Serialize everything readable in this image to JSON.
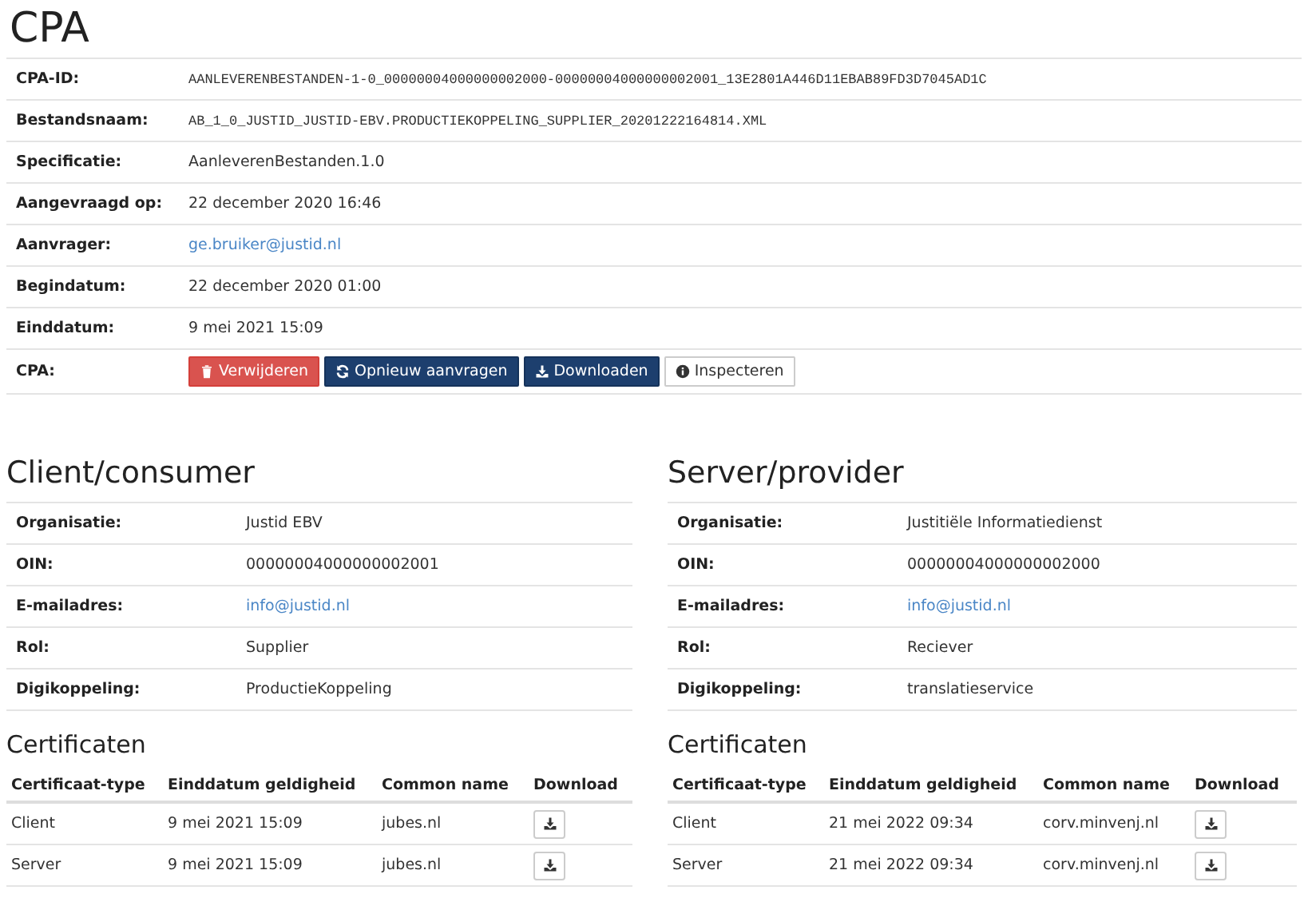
{
  "title": "CPA",
  "details": [
    {
      "label": "CPA-ID:",
      "kind": "mono",
      "value": "AANLEVERENBESTANDEN-1-0_00000004000000002000-00000004000000002001_13E2801A446D11EBAB89FD3D7045AD1C"
    },
    {
      "label": "Bestandsnaam:",
      "kind": "mono",
      "value": "AB_1_0_JUSTID_JUSTID-EBV.PRODUCTIEKOPPELING_SUPPLIER_20201222164814.XML"
    },
    {
      "label": "Specificatie:",
      "kind": "text",
      "value": "AanleverenBestanden.1.0"
    },
    {
      "label": "Aangevraagd op:",
      "kind": "text",
      "value": "22 december 2020 16:46"
    },
    {
      "label": "Aanvrager:",
      "kind": "link",
      "value": "ge.bruiker@justid.nl"
    },
    {
      "label": "Begindatum:",
      "kind": "text",
      "value": "22 december 2020 01:00"
    },
    {
      "label": "Einddatum:",
      "kind": "text",
      "value": "9 mei 2021 15:09"
    },
    {
      "label": "CPA:",
      "kind": "buttons",
      "buttons": [
        {
          "kind": "delete",
          "label": "Verwijderen"
        },
        {
          "kind": "renew",
          "label": "Opnieuw aanvragen"
        },
        {
          "kind": "download",
          "label": "Downloaden"
        },
        {
          "kind": "inspect",
          "label": "Inspecteren"
        }
      ]
    }
  ],
  "parties": [
    {
      "title": "Client/consumer",
      "fields": [
        {
          "label": "Organisatie:",
          "kind": "text",
          "value": "Justid EBV"
        },
        {
          "label": "OIN:",
          "kind": "text",
          "value": "00000004000000002001"
        },
        {
          "label": "E-mailadres:",
          "kind": "link",
          "value": "info@justid.nl"
        },
        {
          "label": "Rol:",
          "kind": "text",
          "value": "Supplier"
        },
        {
          "label": "Digikoppeling:",
          "kind": "text",
          "value": "ProductieKoppeling"
        }
      ],
      "certificates": {
        "title": "Certificaten",
        "columns": [
          "Certificaat-type",
          "Einddatum geldigheid",
          "Common name",
          "Download"
        ],
        "rows": [
          [
            "Client",
            "9 mei 2021 15:09",
            "jubes.nl"
          ],
          [
            "Server",
            "9 mei 2021 15:09",
            "jubes.nl"
          ]
        ]
      }
    },
    {
      "title": "Server/provider",
      "fields": [
        {
          "label": "Organisatie:",
          "kind": "text",
          "value": "Justitiële Informatiedienst"
        },
        {
          "label": "OIN:",
          "kind": "text",
          "value": "00000004000000002000"
        },
        {
          "label": "E-mailadres:",
          "kind": "link",
          "value": "info@justid.nl"
        },
        {
          "label": "Rol:",
          "kind": "text",
          "value": "Reciever"
        },
        {
          "label": "Digikoppeling:",
          "kind": "text",
          "value": "translatieservice"
        }
      ],
      "certificates": {
        "title": "Certificaten",
        "columns": [
          "Certificaat-type",
          "Einddatum geldigheid",
          "Common name",
          "Download"
        ],
        "rows": [
          [
            "Client",
            "21 mei 2022 09:34",
            "corv.minvenj.nl"
          ],
          [
            "Server",
            "21 mei 2022 09:34",
            "corv.minvenj.nl"
          ]
        ]
      }
    }
  ]
}
